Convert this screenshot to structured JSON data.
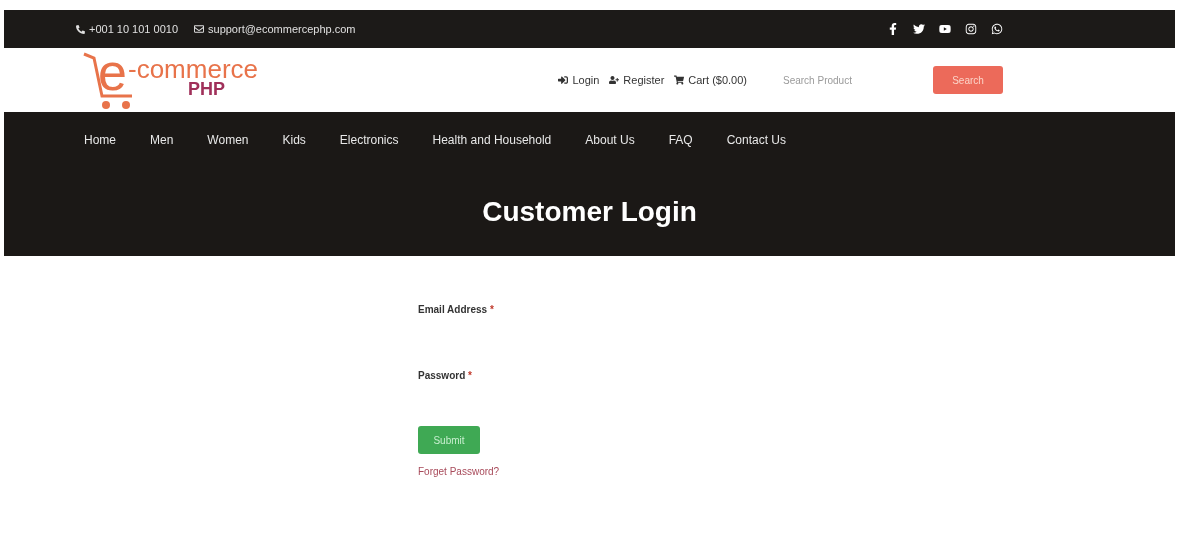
{
  "topbar": {
    "phone": "+001 10 101 0010",
    "email": "support@ecommercephp.com",
    "social": [
      {
        "kind": "facebook"
      },
      {
        "kind": "twitter"
      },
      {
        "kind": "youtube"
      },
      {
        "kind": "instagram"
      },
      {
        "kind": "whatsapp"
      }
    ]
  },
  "header": {
    "logo": {
      "mark": "e",
      "word": "-commerce",
      "sub": "PHP"
    },
    "links": [
      {
        "kind": "login",
        "label": "Login"
      },
      {
        "kind": "register",
        "label": "Register"
      },
      {
        "kind": "cart",
        "label": "Cart ($0.00)"
      }
    ],
    "search": {
      "placeholder": "Search Product",
      "button": "Search"
    }
  },
  "nav": [
    {
      "label": "Home"
    },
    {
      "label": "Men"
    },
    {
      "label": "Women"
    },
    {
      "label": "Kids"
    },
    {
      "label": "Electronics"
    },
    {
      "label": "Health and Household"
    },
    {
      "label": "About Us"
    },
    {
      "label": "FAQ"
    },
    {
      "label": "Contact Us"
    }
  ],
  "banner": {
    "title": "Customer Login"
  },
  "form": {
    "fields": [
      {
        "label": "Email Address",
        "required_mark": "*"
      },
      {
        "label": "Password",
        "required_mark": "*"
      }
    ],
    "submit": "Submit",
    "forgot_link": "Forget Password?"
  }
}
